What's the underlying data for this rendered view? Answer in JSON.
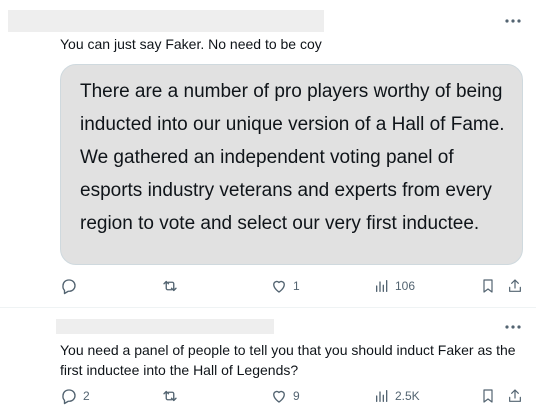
{
  "posts": [
    {
      "reply_text": "You can just say Faker. No need to be coy",
      "quote_text": "There are a number of pro players worthy of being inducted into our unique version of a Hall of Fame. We gathered an independent voting panel of esports industry veterans and experts from every region to vote and select our very first inductee.",
      "actions": {
        "replies": "",
        "reposts": "",
        "likes": "1",
        "views": "106"
      }
    },
    {
      "reply_text": "You need a panel of people to tell you that you should induct Faker as the first inductee into the Hall of Legends?",
      "actions": {
        "replies": "2",
        "reposts": "",
        "likes": "9",
        "views": "2.5K"
      }
    }
  ],
  "icons": {
    "more": "more-horizontal-icon",
    "reply": "reply-icon",
    "repost": "repost-icon",
    "like": "heart-icon",
    "views": "views-icon",
    "bookmark": "bookmark-icon",
    "share": "share-icon"
  },
  "colors": {
    "icon": "#536471",
    "text": "#0f1419",
    "redaction": "#eeeeee",
    "quote_bg": "#e1e1e1"
  }
}
